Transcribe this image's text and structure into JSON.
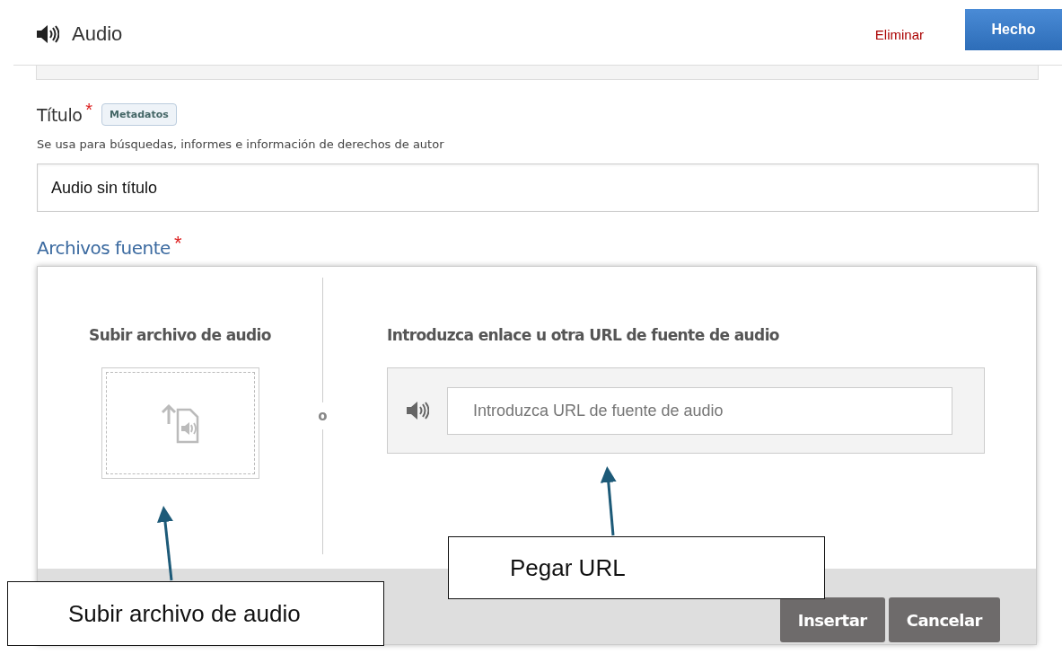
{
  "header": {
    "title": "Audio",
    "delete_link": "Eliminar",
    "done_button": "Hecho"
  },
  "title_field": {
    "label": "Título",
    "required_mark": "*",
    "tag": "Metadatos",
    "hint": "Se usa para búsquedas, informes e información de derechos de autor",
    "value": "Audio sin título"
  },
  "source_section": {
    "heading": "Archivos fuente",
    "required_mark": "*",
    "upload_heading": "Subir archivo de audio",
    "separator": "o",
    "url_heading": "Introduzca enlace u otra URL de fuente de audio",
    "url_placeholder": "Introduzca URL de fuente de audio",
    "buttons": [
      "Insertar",
      "Cancelar"
    ]
  },
  "annotations": [
    {
      "text": "Subir archivo de audio"
    },
    {
      "text": "Pegar URL"
    }
  ]
}
